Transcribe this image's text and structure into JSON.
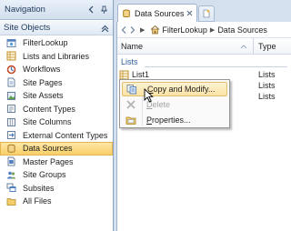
{
  "navigation": {
    "title": "Navigation",
    "section_label": "Site Objects",
    "items": [
      {
        "label": "FilterLookup",
        "icon": "site-icon"
      },
      {
        "label": "Lists and Libraries",
        "icon": "list-icon"
      },
      {
        "label": "Workflows",
        "icon": "workflow-icon"
      },
      {
        "label": "Site Pages",
        "icon": "page-icon"
      },
      {
        "label": "Site Assets",
        "icon": "assets-icon"
      },
      {
        "label": "Content Types",
        "icon": "content-types-icon"
      },
      {
        "label": "Site Columns",
        "icon": "columns-icon"
      },
      {
        "label": "External Content Types",
        "icon": "external-content-icon"
      },
      {
        "label": "Data Sources",
        "icon": "data-source-icon",
        "selected": true
      },
      {
        "label": "Master Pages",
        "icon": "master-page-icon"
      },
      {
        "label": "Site Groups",
        "icon": "groups-icon"
      },
      {
        "label": "Subsites",
        "icon": "subsites-icon"
      },
      {
        "label": "All Files",
        "icon": "folder-icon"
      }
    ]
  },
  "tab": {
    "label": "Data Sources"
  },
  "breadcrumb": {
    "items": [
      "FilterLookup",
      "Data Sources"
    ]
  },
  "columns": {
    "name": "Name",
    "type": "Type"
  },
  "group": {
    "label": "Lists"
  },
  "rows": [
    {
      "name": "List1",
      "type": "Lists"
    },
    {
      "name": "",
      "type": "Lists"
    },
    {
      "name": "",
      "type": "Lists"
    }
  ],
  "context_menu": {
    "items": [
      {
        "label": "Copy and Modify...",
        "underline": "C",
        "rest": "opy and Modify...",
        "enabled": true,
        "highlighted": true
      },
      {
        "label": "Delete",
        "underline": "D",
        "rest": "elete",
        "enabled": false
      },
      {
        "label": "Properties...",
        "underline": "P",
        "rest": "roperties...",
        "enabled": true
      }
    ]
  },
  "colors": {
    "selected_bg": "#f8cf68",
    "pane_border": "#8ea3bf",
    "group_text": "#2e5d9b"
  }
}
